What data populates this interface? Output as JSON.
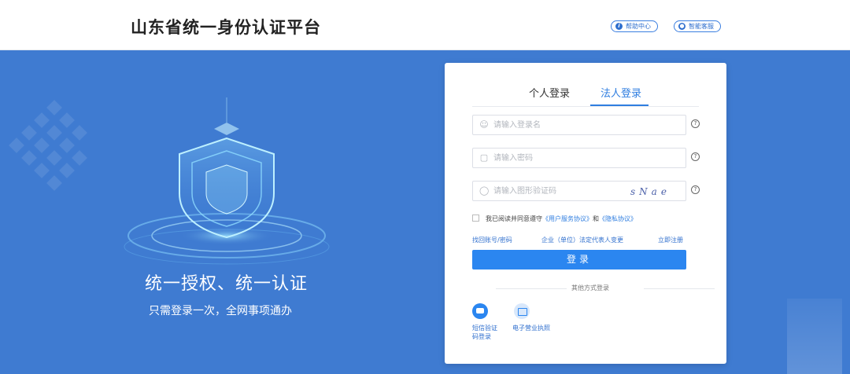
{
  "header": {
    "title": "山东省统一身份认证平台",
    "help_label": "帮助中心",
    "service_label": "智能客服",
    "help_icon": "info-icon",
    "service_icon": "robot-icon"
  },
  "banner": {
    "slogan": "统一授权、统一认证",
    "subslogan": "只需登录一次，全网事项通办"
  },
  "login": {
    "tabs": [
      {
        "label": "个人登录",
        "active": false
      },
      {
        "label": "法人登录",
        "active": true
      }
    ],
    "username_placeholder": "请输入登录名",
    "password_placeholder": "请输入密码",
    "captcha_placeholder": "请输入图形验证码",
    "captcha_text": "sNae",
    "agree_prefix": "我已阅读并同意遵守",
    "agree_link1": "《用户服务协议》",
    "agree_and": "和",
    "agree_link2": "《隐私协议》",
    "link_recover": "找回账号/密码",
    "link_change_rep": "企业（单位）法定代表人变更",
    "link_register": "立即注册",
    "submit_label": "登录",
    "other_methods": "其他方式登录",
    "alt_sms": "短信验证码登录",
    "alt_license": "电子营业执照"
  },
  "colors": {
    "background": "#3f7bd1",
    "accent": "#2b86f0",
    "link": "#2f6fce"
  }
}
